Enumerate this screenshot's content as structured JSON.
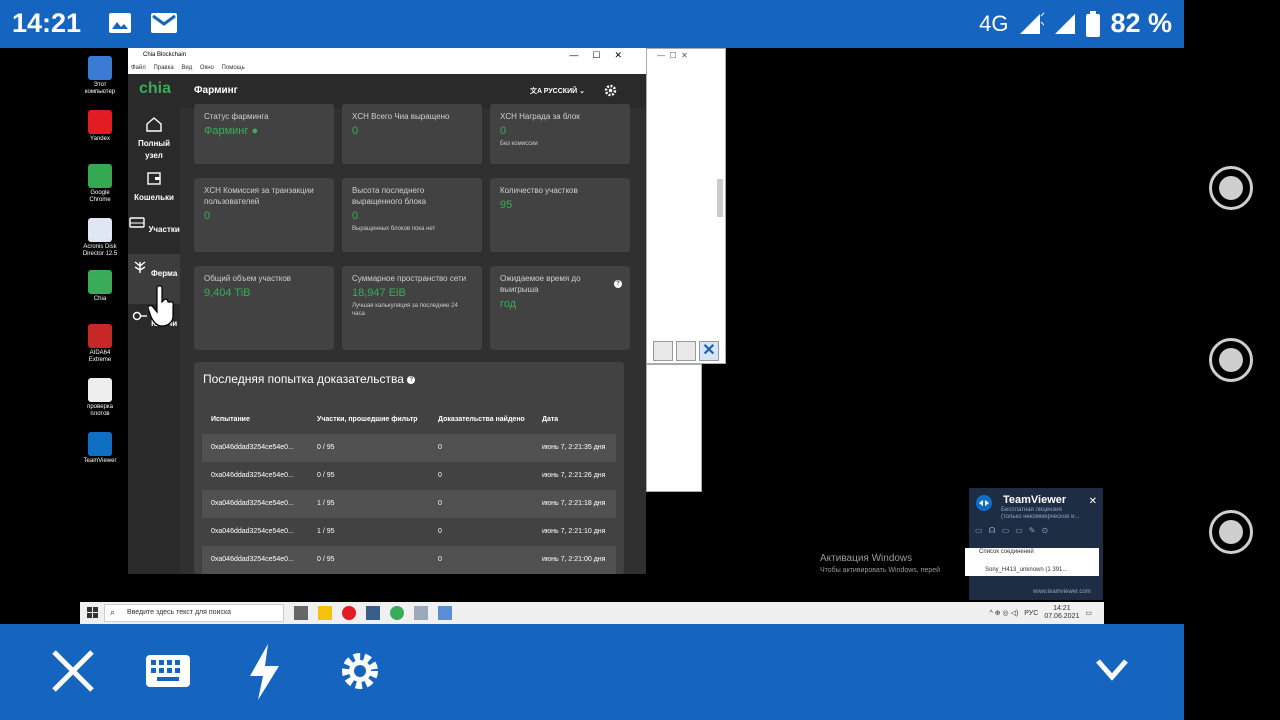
{
  "status_bar": {
    "time": "14:21",
    "network": "4G",
    "battery": "82 %"
  },
  "desktop_icons": [
    {
      "label": "Этот компьютер",
      "icon": "computer-icon",
      "color": "#3a7bd5"
    },
    {
      "label": "Yandex",
      "icon": "yandex-icon",
      "color": "#e31b23"
    },
    {
      "label": "Google Chrome",
      "icon": "chrome-icon",
      "color": "#34a853"
    },
    {
      "label": "Acronis Disk Director 12.5",
      "icon": "acronis-icon",
      "color": "#dfe7f5"
    },
    {
      "label": "Chia",
      "icon": "chia-icon",
      "color": "#3aac59"
    },
    {
      "label": "AIDA64 Extreme",
      "icon": "aida64-icon",
      "color": "#c62828"
    },
    {
      "label": "проверка плотов",
      "icon": "document-icon",
      "color": "#eeeeee"
    },
    {
      "label": "TeamViewer",
      "icon": "teamviewer-icon",
      "color": "#0e6fc5"
    }
  ],
  "chia_window": {
    "title": "Chia Blockchain",
    "menu": [
      "Файл",
      "Правка",
      "Вид",
      "Окно",
      "Помощь"
    ],
    "logo": "chia",
    "page_title": "Фарминг",
    "language": "РУССКИЙ",
    "nav": [
      {
        "label": "Полный узел",
        "icon": "home-icon"
      },
      {
        "label": "Кошельки",
        "icon": "wallet-icon"
      },
      {
        "label": "Участки",
        "icon": "storage-icon"
      },
      {
        "label": "Ферма",
        "icon": "farm-icon"
      },
      {
        "label": "Ключи",
        "icon": "key-icon"
      }
    ],
    "cards": [
      {
        "title": "Статус фарминга",
        "value": "Фарминг ●",
        "note": ""
      },
      {
        "title": "XCH Всего Чиа выращено",
        "value": "0",
        "note": ""
      },
      {
        "title": "XCH Награда за блок",
        "value": "0",
        "note": "Без комиссии"
      },
      {
        "title": "XCH Комиссия за транзакции пользователей",
        "value": "0",
        "note": ""
      },
      {
        "title": "Высота последнего выращенного блока",
        "value": "0",
        "note": "Выращенных блоков пока нет"
      },
      {
        "title": "Количество участков",
        "value": "95",
        "note": ""
      },
      {
        "title": "Общий объем участков",
        "value": "9,404 TiB",
        "note": ""
      },
      {
        "title": "Суммарное пространство сети",
        "value": "18,947 EiB",
        "note": "Лучшая калькуляция за последние 24 часа"
      },
      {
        "title": "Ожидаемое время до выигрыша",
        "value": "год",
        "note": ""
      }
    ],
    "proofs": {
      "title": "Последняя попытка доказательства",
      "columns": [
        "Испытание",
        "Участки, прошедшие фильтр",
        "Доказательства найдено",
        "Дата"
      ],
      "rows": [
        [
          "0xa046ddad3254ce54e0...",
          "0 / 95",
          "0",
          "июнь 7, 2:21:35 дня"
        ],
        [
          "0xa046ddad3254ce54e0...",
          "0 / 95",
          "0",
          "июнь 7, 2:21:26 дня"
        ],
        [
          "0xa046ddad3254ce54e0...",
          "1 / 95",
          "0",
          "июнь 7, 2:21:18 дня"
        ],
        [
          "0xa046ddad3254ce54e0...",
          "1 / 95",
          "0",
          "июнь 7, 2:21:10 дня"
        ],
        [
          "0xa046ddad3254ce54e0...",
          "0 / 95",
          "0",
          "июнь 7, 2:21:00 дня"
        ]
      ]
    }
  },
  "activation": {
    "title": "Активация Windows",
    "subtitle": "Чтобы активировать Windows, перей"
  },
  "taskbar": {
    "search_placeholder": "Введите здесь текст для поиска",
    "lang": "РУС",
    "time": "14:21",
    "date": "07.06.2021"
  },
  "teamviewer": {
    "title": "TeamViewer",
    "subtitle": "Бесплатная лицензия",
    "subtitle2": "(только некоммерческое и...",
    "list_title": "Список соединений",
    "item": "Sony_H413_unknown (1 391...",
    "link": "www.teamviewer.com"
  },
  "colors": {
    "android_blue": "#1565c0",
    "chia_green": "#3aac59"
  }
}
